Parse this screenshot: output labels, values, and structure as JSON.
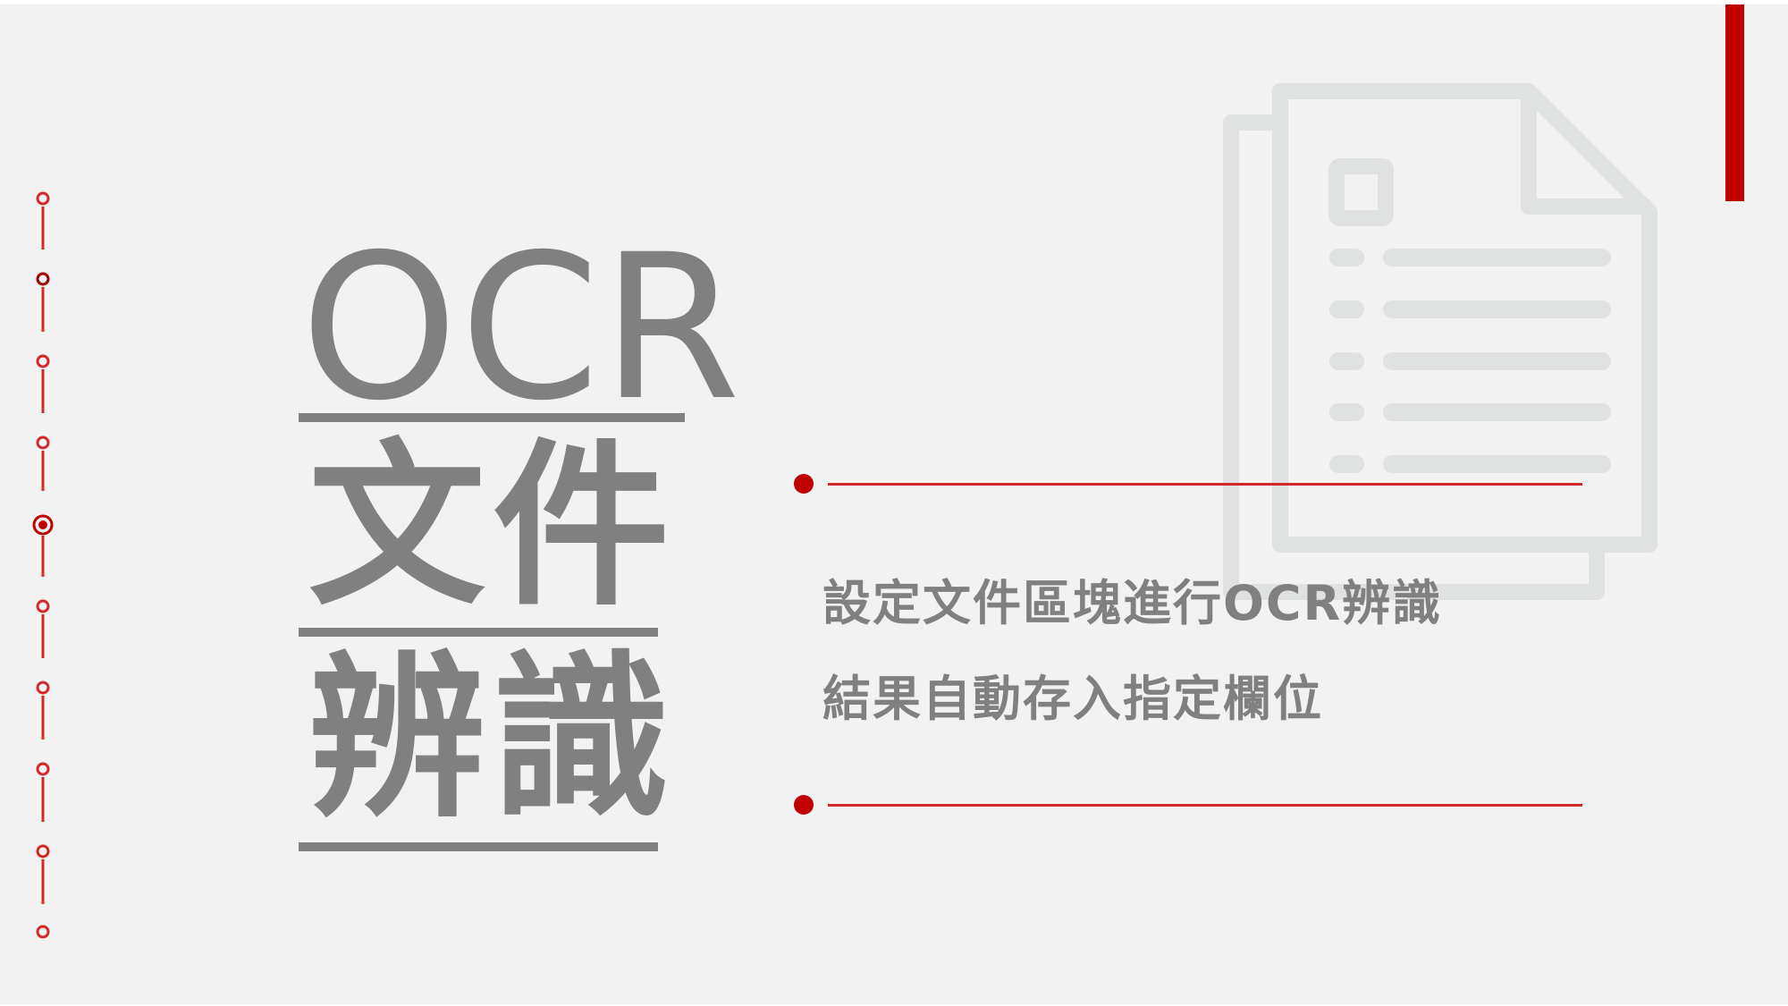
{
  "title": {
    "line1": "OCR",
    "line2": "文件",
    "line3": "辨識"
  },
  "description": {
    "line1": "設定文件區塊進行OCR辨識",
    "line2": "結果自動存入指定欄位"
  },
  "colors": {
    "accent": "#c00000",
    "text": "#808080",
    "background": "#f2f2f2",
    "watermark": "#e0e2e1"
  },
  "icons": {
    "watermark": "document-stack-icon",
    "timeline": "timeline-dots-icon"
  }
}
